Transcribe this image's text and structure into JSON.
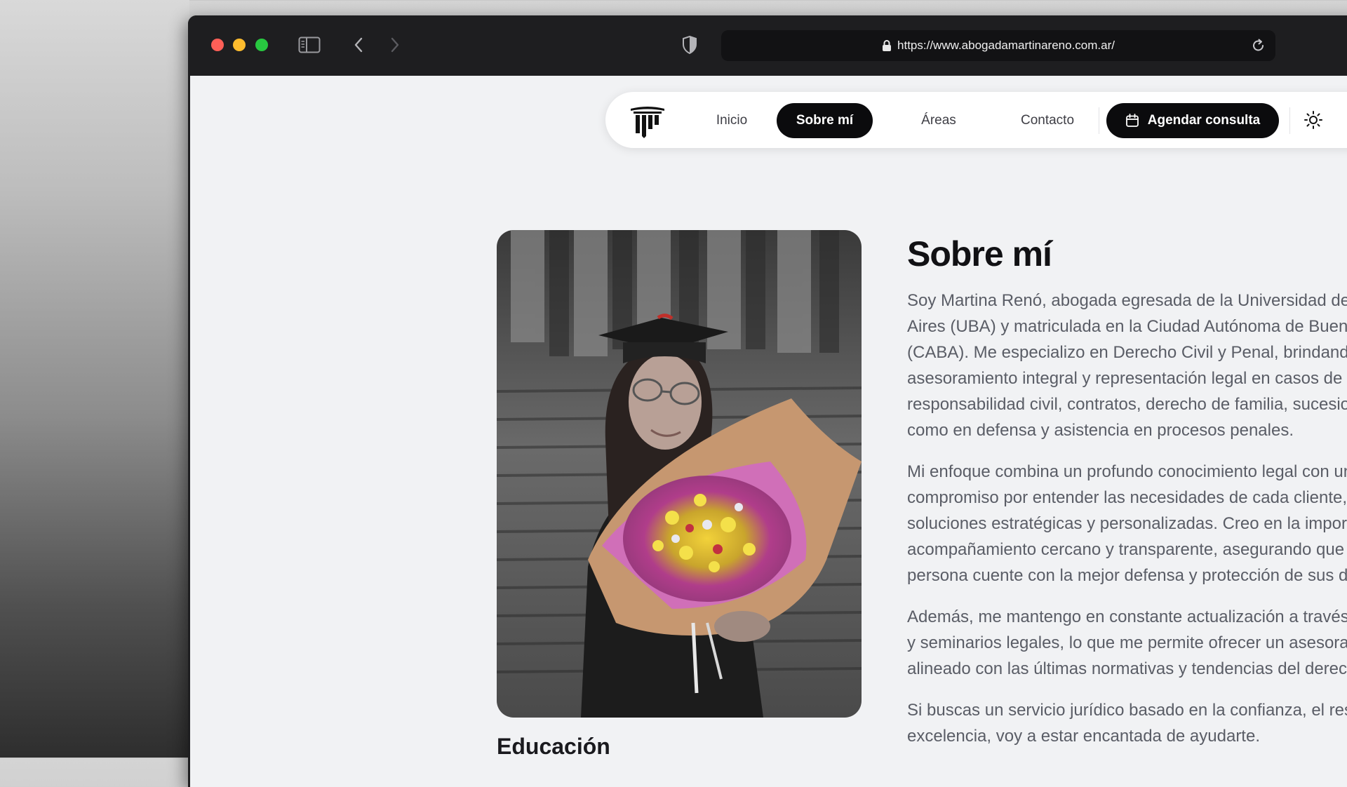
{
  "browser": {
    "url": "https://www.abogadamartinareno.com.ar/"
  },
  "nav": {
    "items": [
      {
        "label": "Inicio"
      },
      {
        "label": "Sobre mí"
      },
      {
        "label": "Áreas"
      },
      {
        "label": "Contacto"
      }
    ],
    "cta_label": "Agendar consulta"
  },
  "about": {
    "title": "Sobre mí",
    "paragraphs": [
      [
        "Soy Martina Renó, abogada egresada de la Universidad de Buenos",
        "Aires (UBA) y matriculada en la Ciudad Autónoma de Buenos Aires",
        "(CABA). Me especializo en Derecho Civil y Penal, brindando",
        "asesoramiento integral y representación legal en casos de",
        "responsabilidad civil, contratos, derecho de familia, sucesiones, así",
        "como en defensa y asistencia en procesos penales."
      ],
      [
        "Mi enfoque combina un profundo conocimiento legal con un",
        "compromiso por entender las necesidades de cada cliente, ofreciendo",
        "soluciones estratégicas y personalizadas. Creo en la importancia de un",
        "acompañamiento cercano y transparente, asegurando que cada",
        "persona cuente con la mejor defensa y protección de sus derechos."
      ],
      [
        "Además, me mantengo en constante actualización a través de cursos",
        "y seminarios legales, lo que me permite ofrecer un asesoramiento",
        "alineado con las últimas normativas y tendencias del derecho."
      ],
      [
        "Si buscas un servicio jurídico basado en la confianza, el respeto y la",
        "excelencia, voy a estar encantada de ayudarte."
      ]
    ],
    "education_title": "Educación"
  },
  "colors": {
    "accent": "#0b0b0d",
    "page_bg": "#f1f2f4",
    "text_muted": "#5a5d66"
  },
  "icons": [
    "sidebar-icon",
    "back-icon",
    "forward-icon",
    "shield-icon",
    "lock-icon",
    "reload-icon",
    "logo-column-icon",
    "calendar-icon",
    "sun-icon"
  ]
}
